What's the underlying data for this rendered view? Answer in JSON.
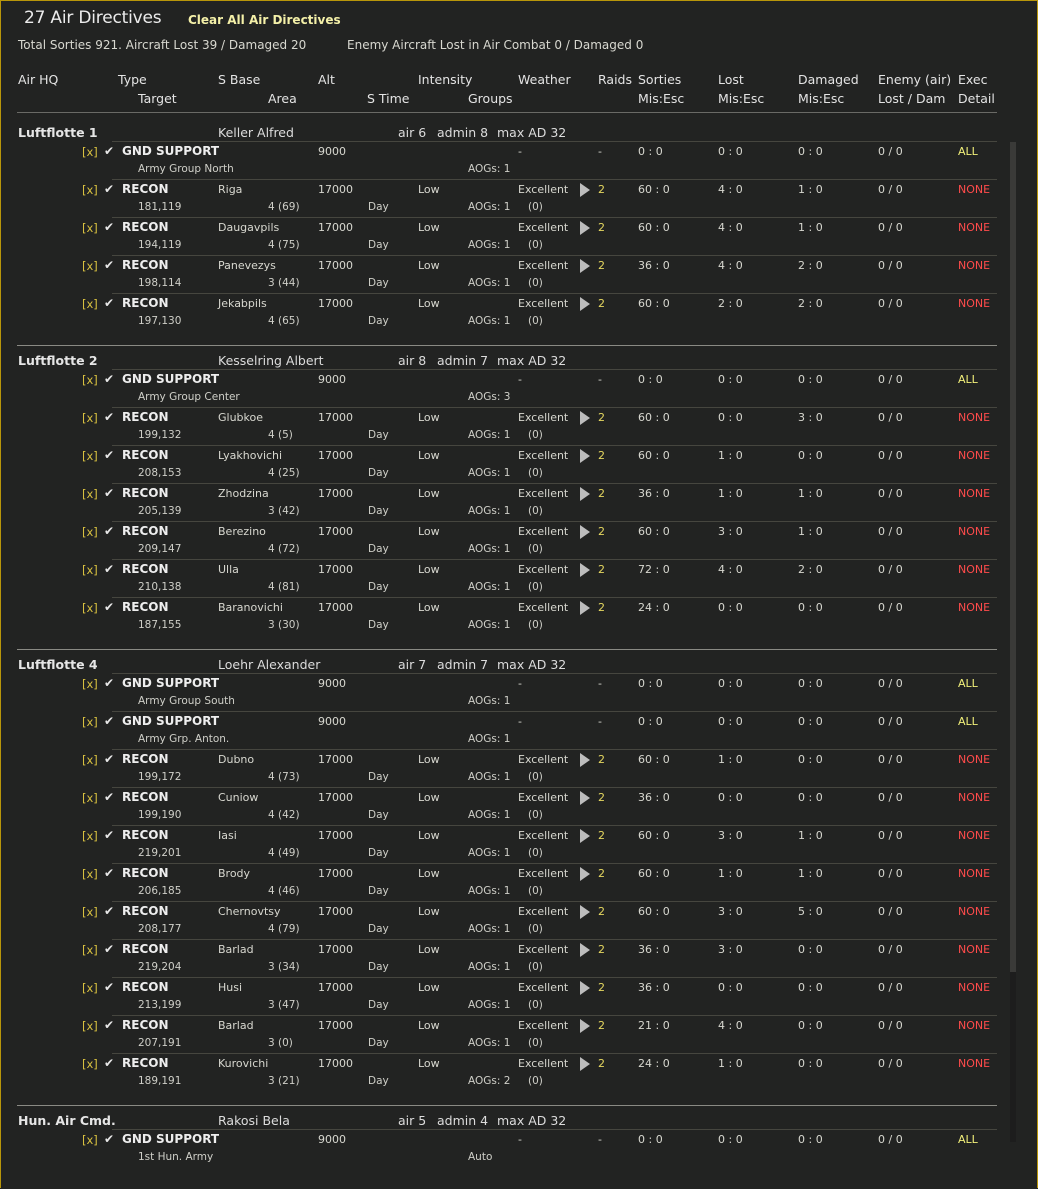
{
  "title": "27 Air Directives",
  "clear_button": "Clear All Air Directives",
  "totals": "Total Sorties 921. Aircraft Lost 39 / Damaged 20",
  "enemy_totals": "Enemy Aircraft Lost in Air Combat 0 / Damaged 0",
  "headers": {
    "air_hq": "Air HQ",
    "type": "Type",
    "target": "Target",
    "s_base": "S Base",
    "area": "Area",
    "alt": "Alt",
    "s_time": "S Time",
    "intensity": "Intensity",
    "groups": "Groups",
    "weather": "Weather",
    "raids": "Raids",
    "sorties": "Sorties",
    "mis_esc1": "Mis:Esc",
    "lost": "Lost",
    "mis_esc2": "Mis:Esc",
    "damaged": "Damaged",
    "mis_esc3": "Mis:Esc",
    "enemy_air": "Enemy (air)",
    "lost_dam": "Lost / Dam",
    "exec": "Exec",
    "detail": "Detail"
  },
  "groups": [
    {
      "name": "Luftflotte 1",
      "commander": "Keller Alfred",
      "air": "air 6",
      "admin": "admin 8",
      "max_ad": "max AD 32",
      "rows": [
        {
          "x": "[x]",
          "type": "GND SUPPORT",
          "base": "",
          "alt": "9000",
          "intensity": "",
          "weather": "-",
          "raids": "-",
          "sorties": "0 : 0",
          "lost": "0 : 0",
          "damaged": "0 : 0",
          "enemy": "0 / 0",
          "exec": "ALL",
          "target": "Army Group North",
          "area": "",
          "stime": "",
          "aogs": "AOGs: 1",
          "groups": ""
        },
        {
          "x": "[x]",
          "type": "RECON",
          "base": "Riga",
          "alt": "17000",
          "intensity": "Low",
          "weather": "Excellent",
          "raids": "2",
          "sorties": "60 : 0",
          "lost": "4 : 0",
          "damaged": "1 : 0",
          "enemy": "0 / 0",
          "exec": "NONE",
          "target": "181,119",
          "area": "4 (69)",
          "stime": "Day",
          "aogs": "AOGs: 1",
          "groups": "(0)"
        },
        {
          "x": "[x]",
          "type": "RECON",
          "base": "Daugavpils",
          "alt": "17000",
          "intensity": "Low",
          "weather": "Excellent",
          "raids": "2",
          "sorties": "60 : 0",
          "lost": "4 : 0",
          "damaged": "1 : 0",
          "enemy": "0 / 0",
          "exec": "NONE",
          "target": "194,119",
          "area": "4 (75)",
          "stime": "Day",
          "aogs": "AOGs: 1",
          "groups": "(0)"
        },
        {
          "x": "[x]",
          "type": "RECON",
          "base": "Panevezys",
          "alt": "17000",
          "intensity": "Low",
          "weather": "Excellent",
          "raids": "2",
          "sorties": "36 : 0",
          "lost": "4 : 0",
          "damaged": "2 : 0",
          "enemy": "0 / 0",
          "exec": "NONE",
          "target": "198,114",
          "area": "3 (44)",
          "stime": "Day",
          "aogs": "AOGs: 1",
          "groups": "(0)"
        },
        {
          "x": "[x]",
          "type": "RECON",
          "base": "Jekabpils",
          "alt": "17000",
          "intensity": "Low",
          "weather": "Excellent",
          "raids": "2",
          "sorties": "60 : 0",
          "lost": "2 : 0",
          "damaged": "2 : 0",
          "enemy": "0 / 0",
          "exec": "NONE",
          "target": "197,130",
          "area": "4 (65)",
          "stime": "Day",
          "aogs": "AOGs: 1",
          "groups": "(0)"
        }
      ]
    },
    {
      "name": "Luftflotte 2",
      "commander": "Kesselring Albert",
      "air": "air 8",
      "admin": "admin 7",
      "max_ad": "max AD 32",
      "rows": [
        {
          "x": "[x]",
          "type": "GND SUPPORT",
          "base": "",
          "alt": "9000",
          "intensity": "",
          "weather": "-",
          "raids": "-",
          "sorties": "0 : 0",
          "lost": "0 : 0",
          "damaged": "0 : 0",
          "enemy": "0 / 0",
          "exec": "ALL",
          "target": "Army Group Center",
          "area": "",
          "stime": "",
          "aogs": "AOGs: 3",
          "groups": ""
        },
        {
          "x": "[x]",
          "type": "RECON",
          "base": "Glubkoe",
          "alt": "17000",
          "intensity": "Low",
          "weather": "Excellent",
          "raids": "2",
          "sorties": "60 : 0",
          "lost": "0 : 0",
          "damaged": "3 : 0",
          "enemy": "0 / 0",
          "exec": "NONE",
          "target": "199,132",
          "area": "4 (5)",
          "stime": "Day",
          "aogs": "AOGs: 1",
          "groups": "(0)"
        },
        {
          "x": "[x]",
          "type": "RECON",
          "base": "Lyakhovichi",
          "alt": "17000",
          "intensity": "Low",
          "weather": "Excellent",
          "raids": "2",
          "sorties": "60 : 0",
          "lost": "1 : 0",
          "damaged": "0 : 0",
          "enemy": "0 / 0",
          "exec": "NONE",
          "target": "208,153",
          "area": "4 (25)",
          "stime": "Day",
          "aogs": "AOGs: 1",
          "groups": "(0)"
        },
        {
          "x": "[x]",
          "type": "RECON",
          "base": "Zhodzina",
          "alt": "17000",
          "intensity": "Low",
          "weather": "Excellent",
          "raids": "2",
          "sorties": "36 : 0",
          "lost": "1 : 0",
          "damaged": "1 : 0",
          "enemy": "0 / 0",
          "exec": "NONE",
          "target": "205,139",
          "area": "3 (42)",
          "stime": "Day",
          "aogs": "AOGs: 1",
          "groups": "(0)"
        },
        {
          "x": "[x]",
          "type": "RECON",
          "base": "Berezino",
          "alt": "17000",
          "intensity": "Low",
          "weather": "Excellent",
          "raids": "2",
          "sorties": "60 : 0",
          "lost": "3 : 0",
          "damaged": "1 : 0",
          "enemy": "0 / 0",
          "exec": "NONE",
          "target": "209,147",
          "area": "4 (72)",
          "stime": "Day",
          "aogs": "AOGs: 1",
          "groups": "(0)"
        },
        {
          "x": "[x]",
          "type": "RECON",
          "base": "Ulla",
          "alt": "17000",
          "intensity": "Low",
          "weather": "Excellent",
          "raids": "2",
          "sorties": "72 : 0",
          "lost": "4 : 0",
          "damaged": "2 : 0",
          "enemy": "0 / 0",
          "exec": "NONE",
          "target": "210,138",
          "area": "4 (81)",
          "stime": "Day",
          "aogs": "AOGs: 1",
          "groups": "(0)"
        },
        {
          "x": "[x]",
          "type": "RECON",
          "base": "Baranovichi",
          "alt": "17000",
          "intensity": "Low",
          "weather": "Excellent",
          "raids": "2",
          "sorties": "24 : 0",
          "lost": "0 : 0",
          "damaged": "0 : 0",
          "enemy": "0 / 0",
          "exec": "NONE",
          "target": "187,155",
          "area": "3 (30)",
          "stime": "Day",
          "aogs": "AOGs: 1",
          "groups": "(0)"
        }
      ]
    },
    {
      "name": "Luftflotte 4",
      "commander": "Loehr Alexander",
      "air": "air 7",
      "admin": "admin 7",
      "max_ad": "max AD 32",
      "rows": [
        {
          "x": "[x]",
          "type": "GND SUPPORT",
          "base": "",
          "alt": "9000",
          "intensity": "",
          "weather": "-",
          "raids": "-",
          "sorties": "0 : 0",
          "lost": "0 : 0",
          "damaged": "0 : 0",
          "enemy": "0 / 0",
          "exec": "ALL",
          "target": "Army Group South",
          "area": "",
          "stime": "",
          "aogs": "AOGs: 1",
          "groups": ""
        },
        {
          "x": "[x]",
          "type": "GND SUPPORT",
          "base": "",
          "alt": "9000",
          "intensity": "",
          "weather": "-",
          "raids": "-",
          "sorties": "0 : 0",
          "lost": "0 : 0",
          "damaged": "0 : 0",
          "enemy": "0 / 0",
          "exec": "ALL",
          "target": "Army Grp. Anton.",
          "area": "",
          "stime": "",
          "aogs": "AOGs: 1",
          "groups": ""
        },
        {
          "x": "[x]",
          "type": "RECON",
          "base": "Dubno",
          "alt": "17000",
          "intensity": "Low",
          "weather": "Excellent",
          "raids": "2",
          "sorties": "60 : 0",
          "lost": "1 : 0",
          "damaged": "0 : 0",
          "enemy": "0 / 0",
          "exec": "NONE",
          "target": "199,172",
          "area": "4 (73)",
          "stime": "Day",
          "aogs": "AOGs: 1",
          "groups": "(0)"
        },
        {
          "x": "[x]",
          "type": "RECON",
          "base": "Cuniow",
          "alt": "17000",
          "intensity": "Low",
          "weather": "Excellent",
          "raids": "2",
          "sorties": "36 : 0",
          "lost": "0 : 0",
          "damaged": "0 : 0",
          "enemy": "0 / 0",
          "exec": "NONE",
          "target": "199,190",
          "area": "4 (42)",
          "stime": "Day",
          "aogs": "AOGs: 1",
          "groups": "(0)"
        },
        {
          "x": "[x]",
          "type": "RECON",
          "base": "Iasi",
          "alt": "17000",
          "intensity": "Low",
          "weather": "Excellent",
          "raids": "2",
          "sorties": "60 : 0",
          "lost": "3 : 0",
          "damaged": "1 : 0",
          "enemy": "0 / 0",
          "exec": "NONE",
          "target": "219,201",
          "area": "4 (49)",
          "stime": "Day",
          "aogs": "AOGs: 1",
          "groups": "(0)"
        },
        {
          "x": "[x]",
          "type": "RECON",
          "base": "Brody",
          "alt": "17000",
          "intensity": "Low",
          "weather": "Excellent",
          "raids": "2",
          "sorties": "60 : 0",
          "lost": "1 : 0",
          "damaged": "1 : 0",
          "enemy": "0 / 0",
          "exec": "NONE",
          "target": "206,185",
          "area": "4 (46)",
          "stime": "Day",
          "aogs": "AOGs: 1",
          "groups": "(0)"
        },
        {
          "x": "[x]",
          "type": "RECON",
          "base": "Chernovtsy",
          "alt": "17000",
          "intensity": "Low",
          "weather": "Excellent",
          "raids": "2",
          "sorties": "60 : 0",
          "lost": "3 : 0",
          "damaged": "5 : 0",
          "enemy": "0 / 0",
          "exec": "NONE",
          "target": "208,177",
          "area": "4 (79)",
          "stime": "Day",
          "aogs": "AOGs: 1",
          "groups": "(0)"
        },
        {
          "x": "[x]",
          "type": "RECON",
          "base": "Barlad",
          "alt": "17000",
          "intensity": "Low",
          "weather": "Excellent",
          "raids": "2",
          "sorties": "36 : 0",
          "lost": "3 : 0",
          "damaged": "0 : 0",
          "enemy": "0 / 0",
          "exec": "NONE",
          "target": "219,204",
          "area": "3 (34)",
          "stime": "Day",
          "aogs": "AOGs: 1",
          "groups": "(0)"
        },
        {
          "x": "[x]",
          "type": "RECON",
          "base": "Husi",
          "alt": "17000",
          "intensity": "Low",
          "weather": "Excellent",
          "raids": "2",
          "sorties": "36 : 0",
          "lost": "0 : 0",
          "damaged": "0 : 0",
          "enemy": "0 / 0",
          "exec": "NONE",
          "target": "213,199",
          "area": "3 (47)",
          "stime": "Day",
          "aogs": "AOGs: 1",
          "groups": "(0)"
        },
        {
          "x": "[x]",
          "type": "RECON",
          "base": "Barlad",
          "alt": "17000",
          "intensity": "Low",
          "weather": "Excellent",
          "raids": "2",
          "sorties": "21 : 0",
          "lost": "4 : 0",
          "damaged": "0 : 0",
          "enemy": "0 / 0",
          "exec": "NONE",
          "target": "207,191",
          "area": "3 (0)",
          "stime": "Day",
          "aogs": "AOGs: 1",
          "groups": "(0)"
        },
        {
          "x": "[x]",
          "type": "RECON",
          "base": "Kurovichi",
          "alt": "17000",
          "intensity": "Low",
          "weather": "Excellent",
          "raids": "2",
          "sorties": "24 : 0",
          "lost": "1 : 0",
          "damaged": "0 : 0",
          "enemy": "0 / 0",
          "exec": "NONE",
          "target": "189,191",
          "area": "3 (21)",
          "stime": "Day",
          "aogs": "AOGs: 2",
          "groups": "(0)"
        }
      ]
    },
    {
      "name": "Hun. Air Cmd.",
      "commander": "Rakosi Bela",
      "air": "air 5",
      "admin": "admin 4",
      "max_ad": "max AD 32",
      "rows": [
        {
          "x": "[x]",
          "type": "GND SUPPORT",
          "base": "",
          "alt": "9000",
          "intensity": "",
          "weather": "-",
          "raids": "-",
          "sorties": "0 : 0",
          "lost": "0 : 0",
          "damaged": "0 : 0",
          "enemy": "0 / 0",
          "exec": "ALL",
          "target": "1st Hun. Army",
          "area": "",
          "stime": "",
          "aogs": "Auto",
          "groups": ""
        }
      ]
    }
  ]
}
